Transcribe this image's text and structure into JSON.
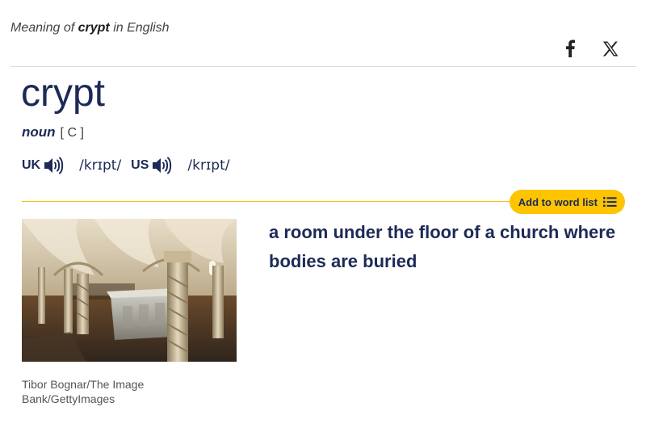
{
  "header": {
    "meaning_prefix": "Meaning of",
    "word": "crypt",
    "meaning_suffix": "in English"
  },
  "share": {
    "facebook_icon": "facebook-icon",
    "x_icon": "x-icon"
  },
  "entry": {
    "headword": "crypt",
    "part_of_speech": "noun",
    "grammar_code": "[ C ]",
    "pronunciations": [
      {
        "region": "UK",
        "ipa": "/krɪpt/",
        "icon": "speaker-icon"
      },
      {
        "region": "US",
        "ipa": "/krɪpt/",
        "icon": "speaker-icon"
      }
    ]
  },
  "actions": {
    "add_to_word_list": "Add to word list",
    "list_icon": "list-icon"
  },
  "sense": {
    "definition": "a room under the floor of a church where bodies are buried",
    "image_credit": "Tibor Bognar/The Image Bank/GettyImages"
  },
  "colors": {
    "headword": "#1d2a57",
    "accent_yellow": "#fec400",
    "rule_yellow": "#f4c20d"
  }
}
